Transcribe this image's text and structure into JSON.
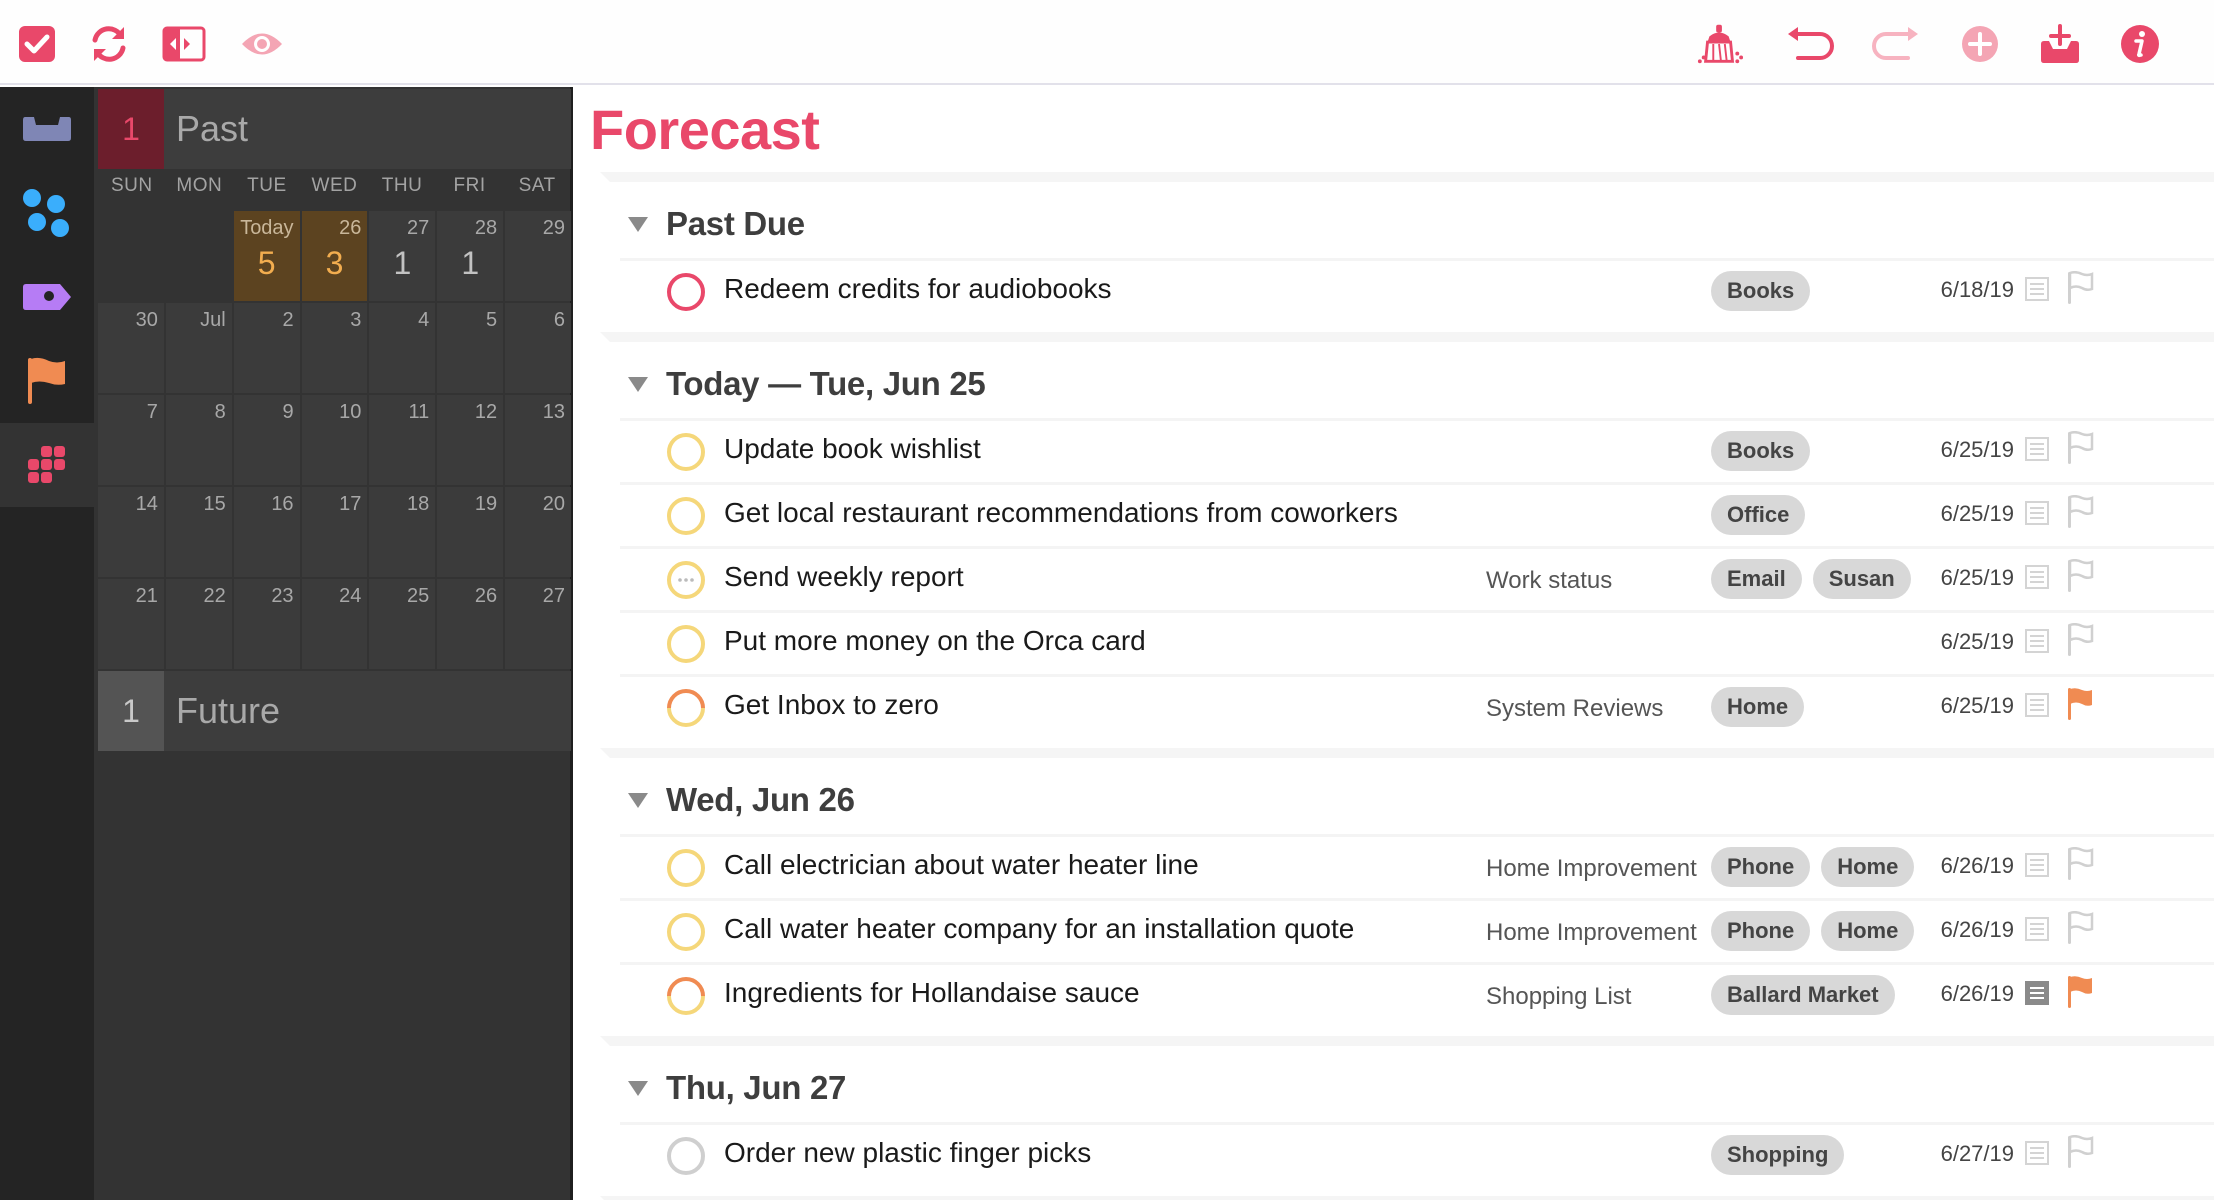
{
  "toolbar": {
    "left": [
      {
        "name": "checkmark-square-icon",
        "label": "Complete"
      },
      {
        "name": "sync-icon",
        "label": "Sync"
      },
      {
        "name": "sidebar-toggle-icon",
        "label": "Toggle Sidebar"
      },
      {
        "name": "eye-icon",
        "label": "View Options"
      }
    ],
    "right": [
      {
        "name": "clean-up-broom-icon",
        "label": "Clean Up"
      },
      {
        "name": "undo-icon",
        "label": "Undo"
      },
      {
        "name": "redo-icon",
        "label": "Redo"
      },
      {
        "name": "add-plus-icon",
        "label": "Add"
      },
      {
        "name": "inbox-add-icon",
        "label": "Quick Entry"
      },
      {
        "name": "info-icon",
        "label": "Inspector"
      }
    ]
  },
  "rail": {
    "items": [
      {
        "name": "inbox",
        "icon": "inbox-tray-icon",
        "color": "#7f86b5"
      },
      {
        "name": "projects",
        "icon": "projects-dots-icon",
        "color": "#3aaefc"
      },
      {
        "name": "tags",
        "icon": "tag-icon",
        "color": "#b67cf5"
      },
      {
        "name": "flagged",
        "icon": "flag-icon",
        "color": "#f08b52"
      },
      {
        "name": "forecast",
        "icon": "forecast-grid-icon",
        "color": "#e9486a",
        "active": true
      }
    ]
  },
  "calendar": {
    "past": {
      "count": "1",
      "label": "Past"
    },
    "future": {
      "count": "1",
      "label": "Future"
    },
    "weekdays": [
      "SUN",
      "MON",
      "TUE",
      "WED",
      "THU",
      "FRI",
      "SAT"
    ],
    "days": [
      {
        "label": "",
        "count": "",
        "empty": true
      },
      {
        "label": "",
        "count": "",
        "empty": true
      },
      {
        "label": "Today",
        "count": "5",
        "highlight": true
      },
      {
        "label": "26",
        "count": "3",
        "highlight": true
      },
      {
        "label": "27",
        "count": "1"
      },
      {
        "label": "28",
        "count": "1"
      },
      {
        "label": "29",
        "count": ""
      },
      {
        "label": "30",
        "count": ""
      },
      {
        "label": "Jul",
        "count": ""
      },
      {
        "label": "2",
        "count": ""
      },
      {
        "label": "3",
        "count": ""
      },
      {
        "label": "4",
        "count": ""
      },
      {
        "label": "5",
        "count": ""
      },
      {
        "label": "6",
        "count": ""
      },
      {
        "label": "7",
        "count": ""
      },
      {
        "label": "8",
        "count": ""
      },
      {
        "label": "9",
        "count": ""
      },
      {
        "label": "10",
        "count": ""
      },
      {
        "label": "11",
        "count": ""
      },
      {
        "label": "12",
        "count": ""
      },
      {
        "label": "13",
        "count": ""
      },
      {
        "label": "14",
        "count": ""
      },
      {
        "label": "15",
        "count": ""
      },
      {
        "label": "16",
        "count": ""
      },
      {
        "label": "17",
        "count": ""
      },
      {
        "label": "18",
        "count": ""
      },
      {
        "label": "19",
        "count": ""
      },
      {
        "label": "20",
        "count": ""
      },
      {
        "label": "21",
        "count": ""
      },
      {
        "label": "22",
        "count": ""
      },
      {
        "label": "23",
        "count": ""
      },
      {
        "label": "24",
        "count": ""
      },
      {
        "label": "25",
        "count": ""
      },
      {
        "label": "26",
        "count": ""
      },
      {
        "label": "27",
        "count": ""
      }
    ]
  },
  "main": {
    "title": "Forecast",
    "colors": {
      "accent": "#e9486a",
      "due_soon": "#f5d77a",
      "flag": "#f08b52",
      "overdue": "#e9486a"
    },
    "groups": [
      {
        "title": "Past Due",
        "tasks": [
          {
            "title": "Redeem credits for audiobooks",
            "project": "",
            "tags": [
              "Books"
            ],
            "due": "6/18/19",
            "status": "overdue",
            "flagged": false,
            "has_note": false
          }
        ]
      },
      {
        "title": "Today — Tue, Jun 25",
        "tasks": [
          {
            "title": "Update book wishlist",
            "project": "",
            "tags": [
              "Books"
            ],
            "due": "6/25/19",
            "status": "due-soon",
            "flagged": false,
            "has_note": false
          },
          {
            "title": "Get local restaurant recommendations from coworkers",
            "project": "",
            "tags": [
              "Office"
            ],
            "due": "6/25/19",
            "status": "due-soon",
            "flagged": false,
            "has_note": false
          },
          {
            "title": "Send weekly report",
            "project": "Work status",
            "tags": [
              "Email",
              "Susan"
            ],
            "due": "6/25/19",
            "status": "due-soon-repeating",
            "flagged": false,
            "has_note": false
          },
          {
            "title": "Put more money on the Orca card",
            "project": "",
            "tags": [],
            "due": "6/25/19",
            "status": "due-soon",
            "flagged": false,
            "has_note": false
          },
          {
            "title": "Get Inbox to zero",
            "project": "System Reviews",
            "tags": [
              "Home"
            ],
            "due": "6/25/19",
            "status": "due-soon-flagged",
            "flagged": true,
            "has_note": false
          }
        ]
      },
      {
        "title": "Wed, Jun 26",
        "tasks": [
          {
            "title": "Call electrician about water heater line",
            "project": "Home Improvement",
            "tags": [
              "Phone",
              "Home"
            ],
            "due": "6/26/19",
            "status": "due-soon",
            "flagged": false,
            "has_note": false
          },
          {
            "title": "Call water heater company for an installation quote",
            "project": "Home Improvement",
            "tags": [
              "Phone",
              "Home"
            ],
            "due": "6/26/19",
            "status": "due-soon",
            "flagged": false,
            "has_note": false
          },
          {
            "title": "Ingredients for Hollandaise sauce",
            "project": "Shopping List",
            "tags": [
              "Ballard Market"
            ],
            "due": "6/26/19",
            "status": "due-soon-flagged",
            "flagged": true,
            "has_note": true
          }
        ]
      },
      {
        "title": "Thu, Jun 27",
        "tasks": [
          {
            "title": "Order new plastic finger picks",
            "project": "",
            "tags": [
              "Shopping"
            ],
            "due": "6/27/19",
            "status": "available",
            "flagged": false,
            "has_note": false
          }
        ]
      }
    ]
  }
}
